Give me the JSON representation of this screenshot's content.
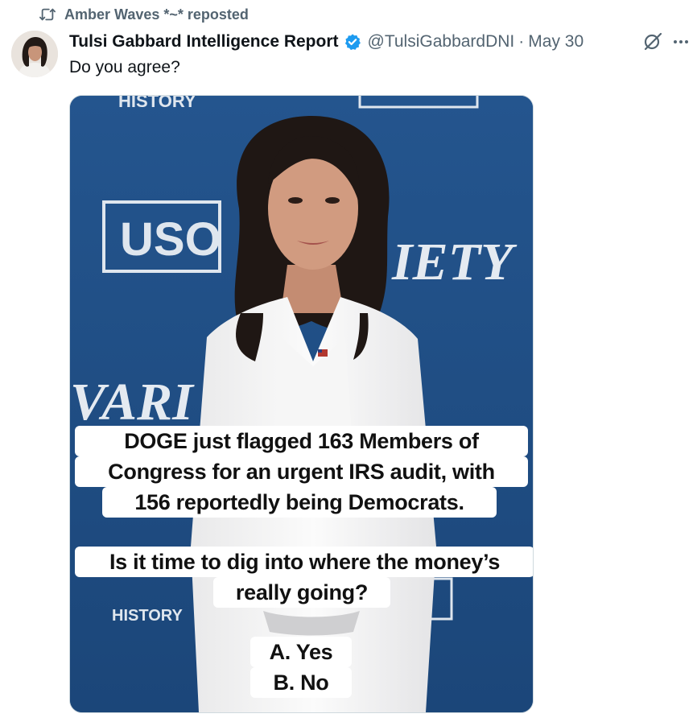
{
  "repost": {
    "label": "Amber Waves *~* reposted",
    "icon": "repost-icon"
  },
  "author": {
    "name": "Tulsi Gabbard Intelligence Report",
    "handle": "@TulsiGabbardDNI",
    "separator": "·",
    "date": "May 30",
    "verified_icon": "verified-badge-icon",
    "verified_color": "#1d9bf0"
  },
  "actions": {
    "grok_icon": "grok-icon",
    "more_icon": "more-icon",
    "more_label": "···"
  },
  "tweet": {
    "text": "Do you agree?"
  },
  "media": {
    "backdrop_color": "#1f4f86",
    "backdrop_text": {
      "history_top": "HISTORY",
      "uso": "USO",
      "iety": "IETY",
      "vari": "VARI",
      "history_bottom": "HISTORY"
    },
    "caption": {
      "line1": "DOGE just flagged 163 Members of",
      "line2": "Congress for an urgent IRS audit, with",
      "line3": "156 reportedly being Democrats.",
      "line4": "Is it time to dig into where the money’s",
      "line5": "really going?",
      "option_a": "A. Yes",
      "option_b": "B. No"
    }
  }
}
